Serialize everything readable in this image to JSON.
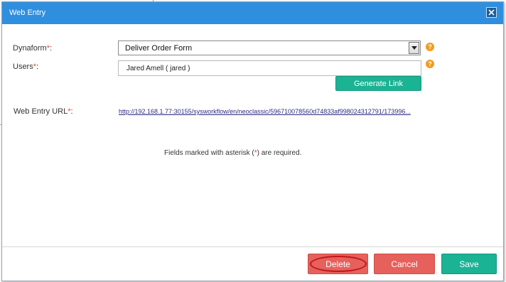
{
  "dialog": {
    "title": "Web Entry",
    "close_label": "×"
  },
  "form": {
    "dynaform_label": "Dynaform",
    "users_label": "Users",
    "url_label": "Web Entry URL",
    "required_mark": "*",
    "colon": ":",
    "dynaform_value": "Deliver Order Form",
    "users_value": "Jared Amell ( jared )",
    "generate_link_label": "Generate Link",
    "url_value": "http://192.168.1.77:30155/sysworkflow/en/neoclassic/596710078560d74833af998024312791/173996...",
    "help_glyph": "?"
  },
  "note": {
    "prefix": "Fields marked with asterisk (",
    "asterisk": "*",
    "suffix": ") are required."
  },
  "footer": {
    "delete_label": "Delete",
    "cancel_label": "Cancel",
    "save_label": "Save"
  },
  "colors": {
    "titlebar": "#2f8fde",
    "accent_green": "#1ab394",
    "danger_red": "#e6605c",
    "required_red": "#e0443c",
    "help_orange": "#f29c1d",
    "annotation_red": "#c0141a"
  },
  "icons": {
    "close": "close-icon",
    "dropdown": "chevron-down-icon",
    "help": "help-icon"
  }
}
